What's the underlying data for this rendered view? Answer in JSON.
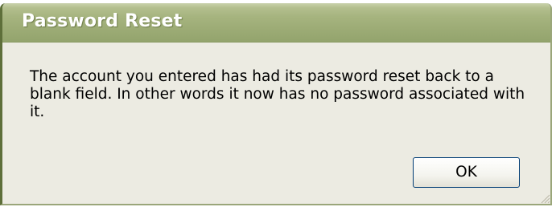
{
  "dialog": {
    "title": "Password Reset",
    "message": "The account you entered has had its password reset back to a blank field. In other words it now has no password associated with it.",
    "ok_label": "OK"
  },
  "colors": {
    "titlebar": "#9dac76",
    "window_body": "#ecebe2",
    "button_border": "#003c74"
  },
  "icons": [
    "resize-grip-icon"
  ]
}
